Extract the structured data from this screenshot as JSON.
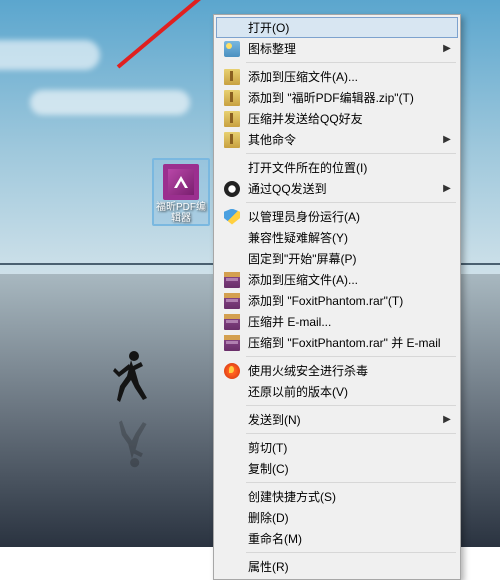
{
  "desktop": {
    "icon_label": "福昕PDF编辑器"
  },
  "menu": {
    "open": "打开(O)",
    "icon_tidy": "图标整理",
    "add_archive_a": "添加到压缩文件(A)...",
    "add_named_zip": "添加到 \"福昕PDF编辑器.zip\"(T)",
    "zip_send_qq": "压缩并发送给QQ好友",
    "other_cmd": "其他命令",
    "open_loc": "打开文件所在的位置(I)",
    "qq_send": "通过QQ发送到",
    "run_admin": "以管理员身份运行(A)",
    "compat": "兼容性疑难解答(Y)",
    "pin_start": "固定到\"开始\"屏幕(P)",
    "add_archive_a2": "添加到压缩文件(A)...",
    "add_foxit_rar": "添加到 \"FoxitPhantom.rar\"(T)",
    "zip_email": "压缩并 E-mail...",
    "zip_foxit_email": "压缩到 \"FoxitPhantom.rar\" 并 E-mail",
    "huorong_scan": "使用火绒安全进行杀毒",
    "restore_ver": "还原以前的版本(V)",
    "send_to": "发送到(N)",
    "cut": "剪切(T)",
    "copy": "复制(C)",
    "shortcut": "创建快捷方式(S)",
    "delete": "删除(D)",
    "rename": "重命名(M)",
    "props": "属性(R)"
  }
}
